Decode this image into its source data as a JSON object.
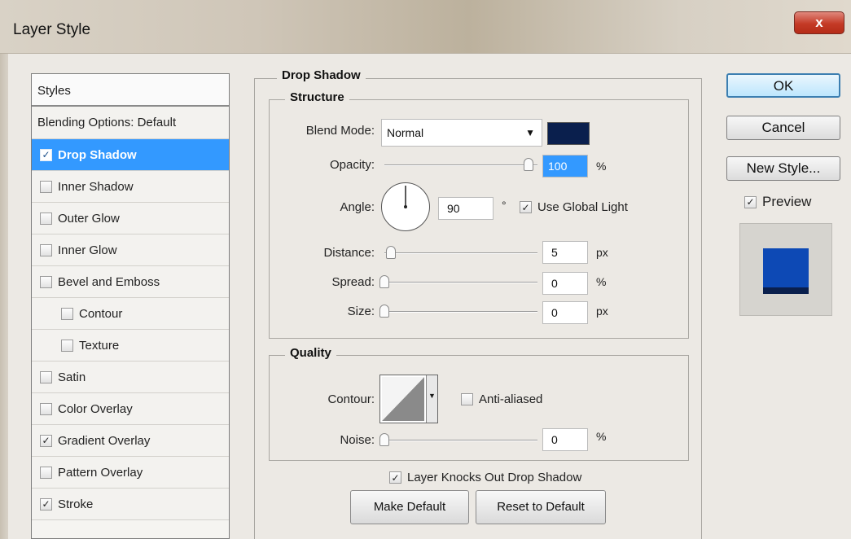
{
  "window": {
    "title": "Layer Style",
    "close_label": "x"
  },
  "styles": {
    "header": "Styles",
    "items": [
      {
        "label": "Blending Options: Default",
        "has_checkbox": false,
        "checked": false,
        "selected": false,
        "indent": false
      },
      {
        "label": "Drop Shadow",
        "has_checkbox": true,
        "checked": true,
        "selected": true,
        "indent": false
      },
      {
        "label": "Inner Shadow",
        "has_checkbox": true,
        "checked": false,
        "selected": false,
        "indent": false
      },
      {
        "label": "Outer Glow",
        "has_checkbox": true,
        "checked": false,
        "selected": false,
        "indent": false
      },
      {
        "label": "Inner Glow",
        "has_checkbox": true,
        "checked": false,
        "selected": false,
        "indent": false
      },
      {
        "label": "Bevel and Emboss",
        "has_checkbox": true,
        "checked": false,
        "selected": false,
        "indent": false
      },
      {
        "label": "Contour",
        "has_checkbox": true,
        "checked": false,
        "selected": false,
        "indent": true
      },
      {
        "label": "Texture",
        "has_checkbox": true,
        "checked": false,
        "selected": false,
        "indent": true
      },
      {
        "label": "Satin",
        "has_checkbox": true,
        "checked": false,
        "selected": false,
        "indent": false
      },
      {
        "label": "Color Overlay",
        "has_checkbox": true,
        "checked": false,
        "selected": false,
        "indent": false
      },
      {
        "label": "Gradient Overlay",
        "has_checkbox": true,
        "checked": true,
        "selected": false,
        "indent": false
      },
      {
        "label": "Pattern Overlay",
        "has_checkbox": true,
        "checked": false,
        "selected": false,
        "indent": false
      },
      {
        "label": "Stroke",
        "has_checkbox": true,
        "checked": true,
        "selected": false,
        "indent": false
      }
    ]
  },
  "drop_shadow": {
    "title": "Drop Shadow",
    "structure": {
      "title": "Structure",
      "blend_mode_label": "Blend Mode:",
      "blend_mode_value": "Normal",
      "shadow_color": "#0a1f4d",
      "opacity_label": "Opacity:",
      "opacity_value": "100",
      "opacity_unit": "%",
      "angle_label": "Angle:",
      "angle_value": "90",
      "angle_unit": "°",
      "use_global_light_label": "Use Global Light",
      "use_global_light_checked": true,
      "distance_label": "Distance:",
      "distance_value": "5",
      "distance_unit": "px",
      "spread_label": "Spread:",
      "spread_value": "0",
      "spread_unit": "%",
      "size_label": "Size:",
      "size_value": "0",
      "size_unit": "px"
    },
    "quality": {
      "title": "Quality",
      "contour_label": "Contour:",
      "anti_aliased_label": "Anti-aliased",
      "anti_aliased_checked": false,
      "noise_label": "Noise:",
      "noise_value": "0",
      "noise_unit": "%"
    },
    "knockout_label": "Layer Knocks Out Drop Shadow",
    "knockout_checked": true,
    "make_default_label": "Make Default",
    "reset_default_label": "Reset to Default"
  },
  "side_buttons": {
    "ok_label": "OK",
    "cancel_label": "Cancel",
    "new_style_label": "New Style...",
    "preview_label": "Preview",
    "preview_checked": true,
    "preview_color": "#0d49b5"
  },
  "check_glyph": "✓"
}
